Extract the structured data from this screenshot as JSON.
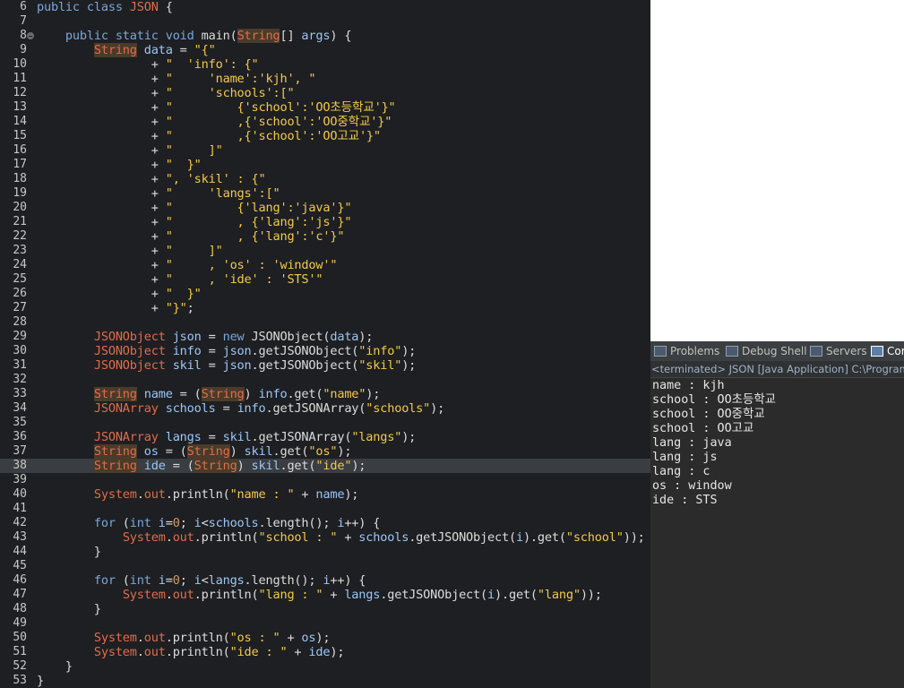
{
  "editor": {
    "lines": [
      {
        "n": "6",
        "segs": [
          [
            "kw",
            "public class "
          ],
          [
            "cls-name",
            "JSON"
          ],
          [
            "cls",
            " {"
          ]
        ]
      },
      {
        "n": "7",
        "segs": []
      },
      {
        "n": "8",
        "fold": true,
        "segs": [
          [
            "kw",
            "    public static void "
          ],
          [
            "cls",
            "main("
          ],
          [
            "type-hl",
            "String"
          ],
          [
            "cls",
            "[] "
          ],
          [
            "var",
            "args"
          ],
          [
            "cls",
            ") {"
          ]
        ]
      },
      {
        "n": "9",
        "segs": [
          [
            "cls",
            "        "
          ],
          [
            "type-hl",
            "String"
          ],
          [
            "cls",
            " "
          ],
          [
            "var",
            "data"
          ],
          [
            "cls",
            " = "
          ],
          [
            "str",
            "\"{\""
          ]
        ]
      },
      {
        "n": "10",
        "segs": [
          [
            "cls",
            "                + "
          ],
          [
            "str",
            "\"  'info': {\""
          ]
        ]
      },
      {
        "n": "11",
        "segs": [
          [
            "cls",
            "                + "
          ],
          [
            "str",
            "\"     'name':'kjh', \""
          ]
        ]
      },
      {
        "n": "12",
        "segs": [
          [
            "cls",
            "                + "
          ],
          [
            "str",
            "\"     'schools':[\""
          ]
        ]
      },
      {
        "n": "13",
        "segs": [
          [
            "cls",
            "                + "
          ],
          [
            "str",
            "\"         {'school':'OO초등학교'}\""
          ]
        ]
      },
      {
        "n": "14",
        "segs": [
          [
            "cls",
            "                + "
          ],
          [
            "str",
            "\"         ,{'school':'OO중학교'}\""
          ]
        ]
      },
      {
        "n": "15",
        "segs": [
          [
            "cls",
            "                + "
          ],
          [
            "str",
            "\"         ,{'school':'OO고교'}\""
          ]
        ]
      },
      {
        "n": "16",
        "segs": [
          [
            "cls",
            "                + "
          ],
          [
            "str",
            "\"     ]\""
          ]
        ]
      },
      {
        "n": "17",
        "segs": [
          [
            "cls",
            "                + "
          ],
          [
            "str",
            "\"  }\""
          ]
        ]
      },
      {
        "n": "18",
        "segs": [
          [
            "cls",
            "                + "
          ],
          [
            "str",
            "\", 'skil' : {\""
          ]
        ]
      },
      {
        "n": "19",
        "segs": [
          [
            "cls",
            "                + "
          ],
          [
            "str",
            "\"     'langs':[\""
          ]
        ]
      },
      {
        "n": "20",
        "segs": [
          [
            "cls",
            "                + "
          ],
          [
            "str",
            "\"         {'lang':'java'}\""
          ]
        ]
      },
      {
        "n": "21",
        "segs": [
          [
            "cls",
            "                + "
          ],
          [
            "str",
            "\"         , {'lang':'js'}\""
          ]
        ]
      },
      {
        "n": "22",
        "segs": [
          [
            "cls",
            "                + "
          ],
          [
            "str",
            "\"         , {'lang':'c'}\""
          ]
        ]
      },
      {
        "n": "23",
        "segs": [
          [
            "cls",
            "                + "
          ],
          [
            "str",
            "\"     ]\""
          ]
        ]
      },
      {
        "n": "24",
        "segs": [
          [
            "cls",
            "                + "
          ],
          [
            "str",
            "\"     , 'os' : 'window'\""
          ]
        ]
      },
      {
        "n": "25",
        "segs": [
          [
            "cls",
            "                + "
          ],
          [
            "str",
            "\"     , 'ide' : 'STS'\""
          ]
        ]
      },
      {
        "n": "26",
        "segs": [
          [
            "cls",
            "                + "
          ],
          [
            "str",
            "\"  }\""
          ]
        ]
      },
      {
        "n": "27",
        "segs": [
          [
            "cls",
            "                + "
          ],
          [
            "str",
            "\"}\""
          ],
          [
            "cls",
            ";"
          ]
        ]
      },
      {
        "n": "28",
        "segs": []
      },
      {
        "n": "29",
        "segs": [
          [
            "cls",
            "        "
          ],
          [
            "type",
            "JSONObject"
          ],
          [
            "cls",
            " "
          ],
          [
            "var",
            "json"
          ],
          [
            "cls",
            " = "
          ],
          [
            "kw",
            "new "
          ],
          [
            "cls",
            "JSONObject("
          ],
          [
            "var",
            "data"
          ],
          [
            "cls",
            ");"
          ]
        ]
      },
      {
        "n": "30",
        "segs": [
          [
            "cls",
            "        "
          ],
          [
            "type",
            "JSONObject"
          ],
          [
            "cls",
            " "
          ],
          [
            "var",
            "info"
          ],
          [
            "cls",
            " = "
          ],
          [
            "var",
            "json"
          ],
          [
            "cls",
            ".getJSONObject("
          ],
          [
            "str",
            "\"info\""
          ],
          [
            "cls",
            ");"
          ]
        ]
      },
      {
        "n": "31",
        "segs": [
          [
            "cls",
            "        "
          ],
          [
            "type",
            "JSONObject"
          ],
          [
            "cls",
            " "
          ],
          [
            "var",
            "skil"
          ],
          [
            "cls",
            " = "
          ],
          [
            "var",
            "json"
          ],
          [
            "cls",
            ".getJSONObject("
          ],
          [
            "str",
            "\"skil\""
          ],
          [
            "cls",
            ");"
          ]
        ]
      },
      {
        "n": "32",
        "segs": []
      },
      {
        "n": "33",
        "segs": [
          [
            "cls",
            "        "
          ],
          [
            "type-hl",
            "String"
          ],
          [
            "cls",
            " "
          ],
          [
            "var",
            "name"
          ],
          [
            "cls",
            " = ("
          ],
          [
            "type-hl",
            "String"
          ],
          [
            "cls",
            ") "
          ],
          [
            "var",
            "info"
          ],
          [
            "cls",
            ".get("
          ],
          [
            "str",
            "\"name\""
          ],
          [
            "cls",
            ");"
          ]
        ]
      },
      {
        "n": "34",
        "segs": [
          [
            "cls",
            "        "
          ],
          [
            "type",
            "JSONArray"
          ],
          [
            "cls",
            " "
          ],
          [
            "var",
            "schools"
          ],
          [
            "cls",
            " = "
          ],
          [
            "var",
            "info"
          ],
          [
            "cls",
            ".getJSONArray("
          ],
          [
            "str",
            "\"schools\""
          ],
          [
            "cls",
            ");"
          ]
        ]
      },
      {
        "n": "35",
        "segs": []
      },
      {
        "n": "36",
        "segs": [
          [
            "cls",
            "        "
          ],
          [
            "type",
            "JSONArray"
          ],
          [
            "cls",
            " "
          ],
          [
            "var",
            "langs"
          ],
          [
            "cls",
            " = "
          ],
          [
            "var",
            "skil"
          ],
          [
            "cls",
            ".getJSONArray("
          ],
          [
            "str",
            "\"langs\""
          ],
          [
            "cls",
            ");"
          ]
        ]
      },
      {
        "n": "37",
        "segs": [
          [
            "cls",
            "        "
          ],
          [
            "type-hl",
            "String"
          ],
          [
            "cls",
            " "
          ],
          [
            "var",
            "os"
          ],
          [
            "cls",
            " = ("
          ],
          [
            "type-hl",
            "String"
          ],
          [
            "cls",
            ") "
          ],
          [
            "var",
            "skil"
          ],
          [
            "cls",
            ".get("
          ],
          [
            "str",
            "\"os\""
          ],
          [
            "cls",
            ");"
          ]
        ]
      },
      {
        "n": "38",
        "current": true,
        "segs": [
          [
            "cls",
            "        "
          ],
          [
            "type-hl",
            "String"
          ],
          [
            "cls",
            " "
          ],
          [
            "var",
            "ide"
          ],
          [
            "cls",
            " = ("
          ],
          [
            "type-hl",
            "String"
          ],
          [
            "cls",
            ") "
          ],
          [
            "var",
            "skil"
          ],
          [
            "cls",
            ".get("
          ],
          [
            "str",
            "\"ide\""
          ],
          [
            "cls",
            ");"
          ]
        ]
      },
      {
        "n": "39",
        "segs": []
      },
      {
        "n": "40",
        "segs": [
          [
            "cls",
            "        "
          ],
          [
            "type",
            "System"
          ],
          [
            "cls",
            "."
          ],
          [
            "type",
            "out"
          ],
          [
            "cls",
            ".println("
          ],
          [
            "str",
            "\"name : \""
          ],
          [
            "cls",
            " + "
          ],
          [
            "var",
            "name"
          ],
          [
            "cls",
            ");"
          ]
        ]
      },
      {
        "n": "41",
        "segs": []
      },
      {
        "n": "42",
        "segs": [
          [
            "cls",
            "        "
          ],
          [
            "kw",
            "for"
          ],
          [
            "cls",
            " ("
          ],
          [
            "kw",
            "int "
          ],
          [
            "var",
            "i"
          ],
          [
            "cls",
            "="
          ],
          [
            "num",
            "0"
          ],
          [
            "cls",
            "; "
          ],
          [
            "var",
            "i"
          ],
          [
            "cls",
            "<"
          ],
          [
            "var",
            "schools"
          ],
          [
            "cls",
            ".length(); "
          ],
          [
            "var",
            "i"
          ],
          [
            "cls",
            "++) {"
          ]
        ]
      },
      {
        "n": "43",
        "segs": [
          [
            "cls",
            "            "
          ],
          [
            "type",
            "System"
          ],
          [
            "cls",
            "."
          ],
          [
            "type",
            "out"
          ],
          [
            "cls",
            ".println("
          ],
          [
            "str",
            "\"school : \""
          ],
          [
            "cls",
            " + "
          ],
          [
            "var",
            "schools"
          ],
          [
            "cls",
            ".getJSONObject("
          ],
          [
            "var",
            "i"
          ],
          [
            "cls",
            ").get("
          ],
          [
            "str",
            "\"school\""
          ],
          [
            "cls",
            "));"
          ]
        ]
      },
      {
        "n": "44",
        "segs": [
          [
            "cls",
            "        }"
          ]
        ]
      },
      {
        "n": "45",
        "segs": []
      },
      {
        "n": "46",
        "segs": [
          [
            "cls",
            "        "
          ],
          [
            "kw",
            "for"
          ],
          [
            "cls",
            " ("
          ],
          [
            "kw",
            "int "
          ],
          [
            "var",
            "i"
          ],
          [
            "cls",
            "="
          ],
          [
            "num",
            "0"
          ],
          [
            "cls",
            "; "
          ],
          [
            "var",
            "i"
          ],
          [
            "cls",
            "<"
          ],
          [
            "var",
            "langs"
          ],
          [
            "cls",
            ".length(); "
          ],
          [
            "var",
            "i"
          ],
          [
            "cls",
            "++) {"
          ]
        ]
      },
      {
        "n": "47",
        "segs": [
          [
            "cls",
            "            "
          ],
          [
            "type",
            "System"
          ],
          [
            "cls",
            "."
          ],
          [
            "type",
            "out"
          ],
          [
            "cls",
            ".println("
          ],
          [
            "str",
            "\"lang : \""
          ],
          [
            "cls",
            " + "
          ],
          [
            "var",
            "langs"
          ],
          [
            "cls",
            ".getJSONObject("
          ],
          [
            "var",
            "i"
          ],
          [
            "cls",
            ").get("
          ],
          [
            "str",
            "\"lang\""
          ],
          [
            "cls",
            "));"
          ]
        ]
      },
      {
        "n": "48",
        "segs": [
          [
            "cls",
            "        }"
          ]
        ]
      },
      {
        "n": "49",
        "segs": []
      },
      {
        "n": "50",
        "segs": [
          [
            "cls",
            "        "
          ],
          [
            "type",
            "System"
          ],
          [
            "cls",
            "."
          ],
          [
            "type",
            "out"
          ],
          [
            "cls",
            ".println("
          ],
          [
            "str",
            "\"os : \""
          ],
          [
            "cls",
            " + "
          ],
          [
            "var",
            "os"
          ],
          [
            "cls",
            ");"
          ]
        ]
      },
      {
        "n": "51",
        "segs": [
          [
            "cls",
            "        "
          ],
          [
            "type",
            "System"
          ],
          [
            "cls",
            "."
          ],
          [
            "type",
            "out"
          ],
          [
            "cls",
            ".println("
          ],
          [
            "str",
            "\"ide : \""
          ],
          [
            "cls",
            " + "
          ],
          [
            "var",
            "ide"
          ],
          [
            "cls",
            ");"
          ]
        ]
      },
      {
        "n": "52",
        "segs": [
          [
            "cls",
            "    }"
          ]
        ]
      },
      {
        "n": "53",
        "segs": [
          [
            "cls",
            "}"
          ]
        ]
      }
    ]
  },
  "console": {
    "tabs": [
      {
        "label": "Problems",
        "icon": "problems-icon"
      },
      {
        "label": "Debug Shell",
        "icon": "debug-shell-icon"
      },
      {
        "label": "Servers",
        "icon": "servers-icon"
      },
      {
        "label": "Cor",
        "icon": "console-icon"
      }
    ],
    "status": "<terminated> JSON [Java Application] C:\\Program F",
    "output": [
      "name : kjh",
      "school : OO초등학교",
      "school : OO중학교",
      "school : OO고교",
      "lang : java",
      "lang : js",
      "lang : c",
      "os : window",
      "ide : STS"
    ]
  }
}
